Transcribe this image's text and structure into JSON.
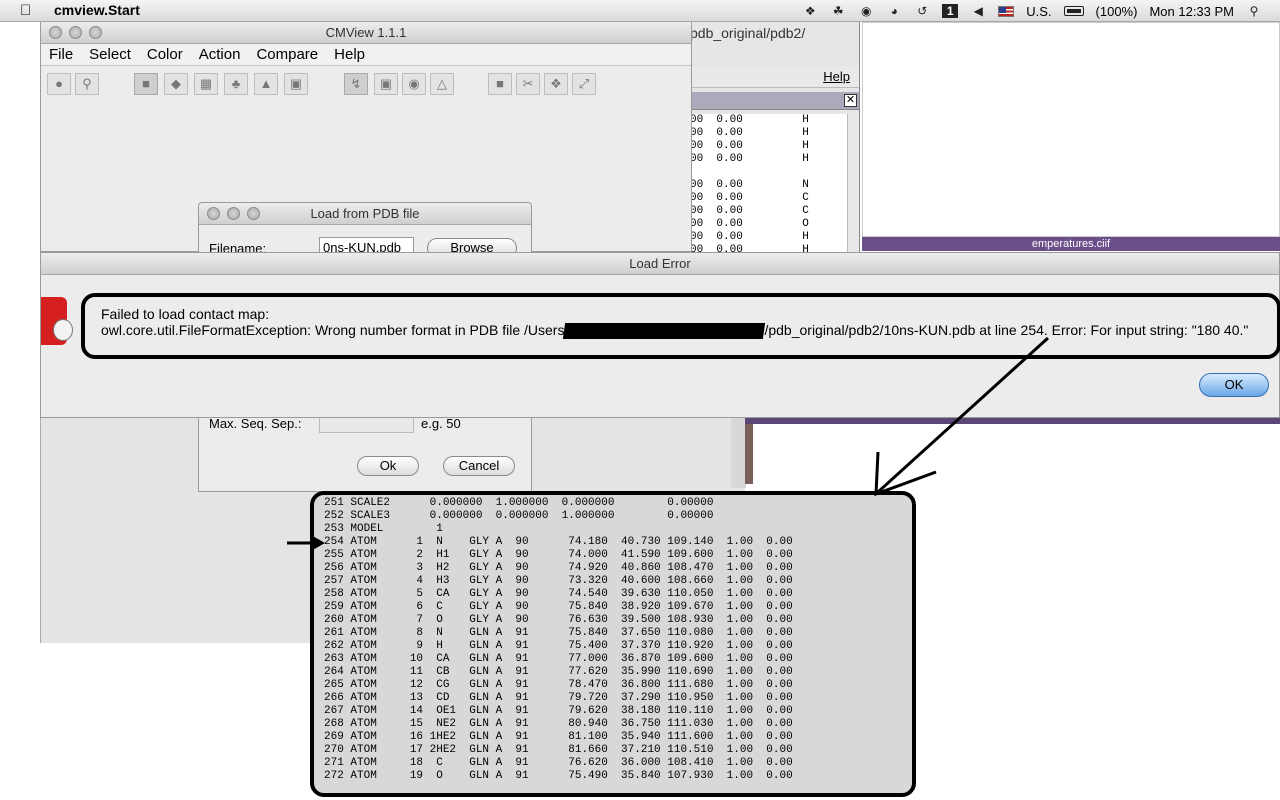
{
  "menubar": {
    "app_name": "cmview.Start",
    "keyboard": "U.S.",
    "battery": "(100%)",
    "clock": "Mon 12:33 PM",
    "icons": [
      "dropbox-icon",
      "evernote-icon",
      "sync-icon",
      "wifi-icon",
      "time-machine-icon",
      "spaces-icon",
      "volume-icon",
      "flag-icon",
      "battery-icon",
      "spotlight-icon"
    ]
  },
  "bg_editor": {
    "path": "pdb_original/pdb2/",
    "help": "Help",
    "lines": [
      "00  0.00         H",
      "00  0.00         H",
      "00  0.00         H",
      "00  0.00         H",
      "",
      "00  0.00         N",
      "00  0.00         C",
      "00  0.00         C",
      "00  0.00         O",
      "00  0.00         H",
      "00  0.00         H"
    ]
  },
  "bg_desktop": {
    "file_label": "emperatures.ciif"
  },
  "cmview": {
    "title": "CMView 1.1.1",
    "menu": [
      "File",
      "Select",
      "Color",
      "Action",
      "Compare",
      "Help"
    ]
  },
  "pdb_dialog": {
    "title": "Load from PDB file",
    "filename_label": "Filename:",
    "filename_value": "0ns-KUN.pdb",
    "browse": "Browse",
    "maxseq_label": "Max. Seq. Sep.:",
    "maxseq_hint": "e.g. 50",
    "ok": "Ok",
    "cancel": "Cancel"
  },
  "error_dialog": {
    "title": "Load Error",
    "line1": "Failed to load contact map:",
    "line2_prefix": "owl.core.util.FileFormatException: Wrong number format in PDB file /Users",
    "line2_suffix": "/pdb_original/pdb2/10ns-KUN.pdb at line 254. Error: For input string: \"180 40.\"",
    "ok": "OK"
  },
  "pdb_excerpt": [
    "251 SCALE2      0.000000  1.000000  0.000000        0.00000",
    "252 SCALE3      0.000000  0.000000  1.000000        0.00000",
    "253 MODEL        1",
    "254 ATOM      1  N    GLY A  90      74.180  40.730 109.140  1.00  0.00",
    "255 ATOM      2  H1   GLY A  90      74.000  41.590 109.600  1.00  0.00",
    "256 ATOM      3  H2   GLY A  90      74.920  40.860 108.470  1.00  0.00",
    "257 ATOM      4  H3   GLY A  90      73.320  40.600 108.660  1.00  0.00",
    "258 ATOM      5  CA   GLY A  90      74.540  39.630 110.050  1.00  0.00",
    "259 ATOM      6  C    GLY A  90      75.840  38.920 109.670  1.00  0.00",
    "260 ATOM      7  O    GLY A  90      76.630  39.500 108.930  1.00  0.00",
    "261 ATOM      8  N    GLN A  91      75.840  37.650 110.080  1.00  0.00",
    "262 ATOM      9  H    GLN A  91      75.400  37.370 110.920  1.00  0.00",
    "263 ATOM     10  CA   GLN A  91      77.000  36.870 109.600  1.00  0.00",
    "264 ATOM     11  CB   GLN A  91      77.620  35.990 110.690  1.00  0.00",
    "265 ATOM     12  CG   GLN A  91      78.470  36.800 111.680  1.00  0.00",
    "266 ATOM     13  CD   GLN A  91      79.720  37.290 110.950  1.00  0.00",
    "267 ATOM     14  OE1  GLN A  91      79.620  38.180 110.110  1.00  0.00",
    "268 ATOM     15  NE2  GLN A  91      80.940  36.750 111.030  1.00  0.00",
    "269 ATOM     16 1HE2  GLN A  91      81.100  35.940 111.600  1.00  0.00",
    "270 ATOM     17 2HE2  GLN A  91      81.660  37.210 110.510  1.00  0.00",
    "271 ATOM     18  C    GLN A  91      76.620  36.000 108.410  1.00  0.00",
    "272 ATOM     19  O    GLN A  91      75.490  35.840 107.930  1.00  0.00"
  ]
}
